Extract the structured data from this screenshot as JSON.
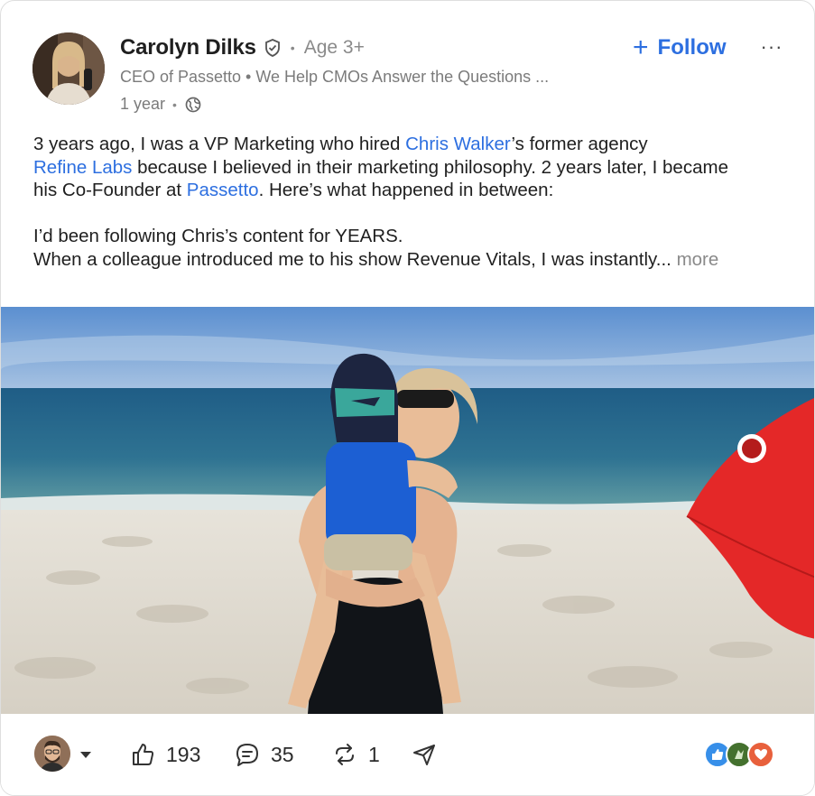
{
  "author": {
    "name": "Carolyn Dilks",
    "badge_icon": "shield-check-icon",
    "age": "Age 3+",
    "headline": "CEO of Passetto • We Help CMOs Answer the Questions ...",
    "time": "1 year",
    "visibility_icon": "globe-icon"
  },
  "actions": {
    "follow_icon": "plus-icon",
    "follow_label": "Follow",
    "menu_label": "···"
  },
  "post": {
    "l1_a": "3 years ago, I was a VP Marketing who hired ",
    "l1_link": "Chris Walker",
    "l1_b": "’s former agency",
    "l2_link": "Refine Labs",
    "l2_b": " because I believed in their marketing philosophy. 2 years later, I became",
    "l3_a": "his Co-Founder at ",
    "l3_link": "Passetto",
    "l3_b": ". Here’s what happened in between:",
    "l4": "I’d been following Chris’s content for YEARS.",
    "l5": "When a colleague introduced me to his show Revenue Vitals, I was instantly... ",
    "more_label": "more"
  },
  "footer": {
    "like_count": "193",
    "comment_count": "35",
    "repost_count": "1",
    "icons": [
      "thumbs-up-icon",
      "comment-icon",
      "repost-icon",
      "send-icon"
    ]
  },
  "colors": {
    "accent": "#2d6fe0",
    "muted": "#8a8a8a",
    "love": "#e8603c",
    "like": "#378fe9",
    "celebrate": "#44712e"
  }
}
